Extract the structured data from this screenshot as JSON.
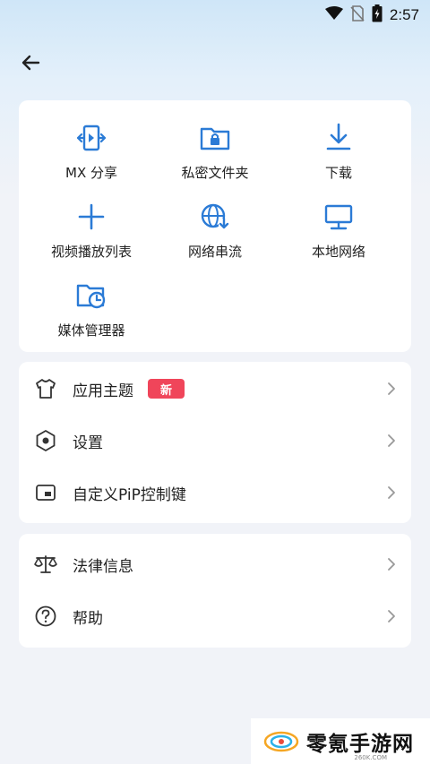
{
  "status_bar": {
    "time": "2:57"
  },
  "grid": {
    "items": [
      {
        "label": "MX 分享",
        "icon": "mx-share-icon"
      },
      {
        "label": "私密文件夹",
        "icon": "private-folder-icon"
      },
      {
        "label": "下载",
        "icon": "download-icon"
      },
      {
        "label": "视频播放列表",
        "icon": "add-playlist-icon"
      },
      {
        "label": "网络串流",
        "icon": "network-stream-icon"
      },
      {
        "label": "本地网络",
        "icon": "local-network-icon"
      },
      {
        "label": "媒体管理器",
        "icon": "media-manager-icon"
      }
    ]
  },
  "menu1": {
    "items": [
      {
        "label": "应用主题",
        "icon": "tshirt-icon",
        "badge": "新"
      },
      {
        "label": "设置",
        "icon": "settings-hexagon-icon"
      },
      {
        "label": "自定义PiP控制键",
        "icon": "pip-icon"
      }
    ]
  },
  "menu2": {
    "items": [
      {
        "label": "法律信息",
        "icon": "scales-icon"
      },
      {
        "label": "帮助",
        "icon": "help-icon"
      }
    ]
  },
  "watermark": {
    "text": "零氪手游网",
    "sub": "260K.COM"
  },
  "colors": {
    "accent": "#2b7bd6",
    "badge": "#f0455a",
    "card": "#ffffff"
  }
}
